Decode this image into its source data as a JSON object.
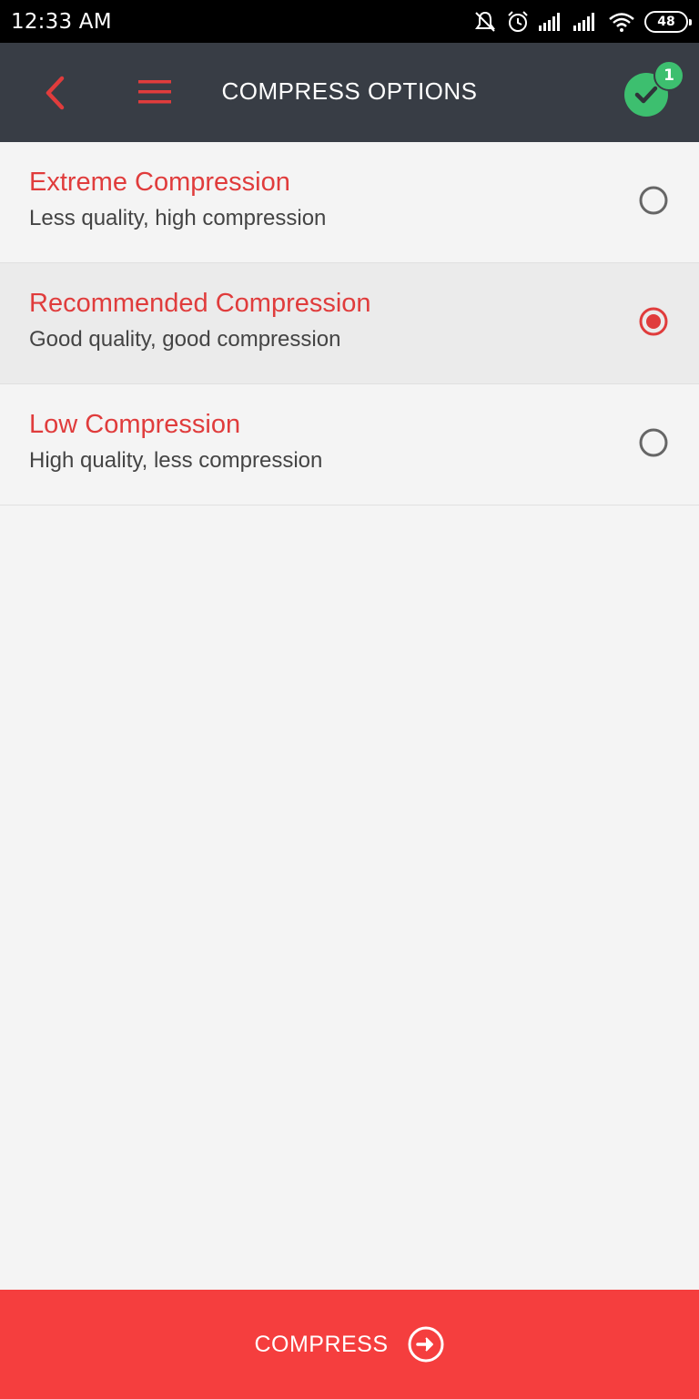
{
  "status_bar": {
    "time": "12:33 AM",
    "battery": "48",
    "icons": [
      "mute-bell-icon",
      "alarm-icon",
      "signal-icon",
      "signal-icon",
      "wifi-icon",
      "battery-icon"
    ]
  },
  "app_bar": {
    "title": "COMPRESS OPTIONS",
    "back_icon": "chevron-left-icon",
    "menu_icon": "hamburger-menu-icon",
    "confirm_icon": "check-icon",
    "badge_count": "1"
  },
  "options": [
    {
      "title": "Extreme Compression",
      "subtitle": "Less quality, high compression",
      "selected": false
    },
    {
      "title": "Recommended Compression",
      "subtitle": "Good quality, good compression",
      "selected": true
    },
    {
      "title": "Low Compression",
      "subtitle": "High quality, less compression",
      "selected": false
    }
  ],
  "footer": {
    "compress_label": "COMPRESS",
    "compress_icon": "arrow-right-circle-icon"
  },
  "colors": {
    "accent": "#e03c3c",
    "button": "#f53e3e",
    "app_bar": "#383d45",
    "confirm": "#3dbf6f",
    "background": "#f4f4f4"
  }
}
